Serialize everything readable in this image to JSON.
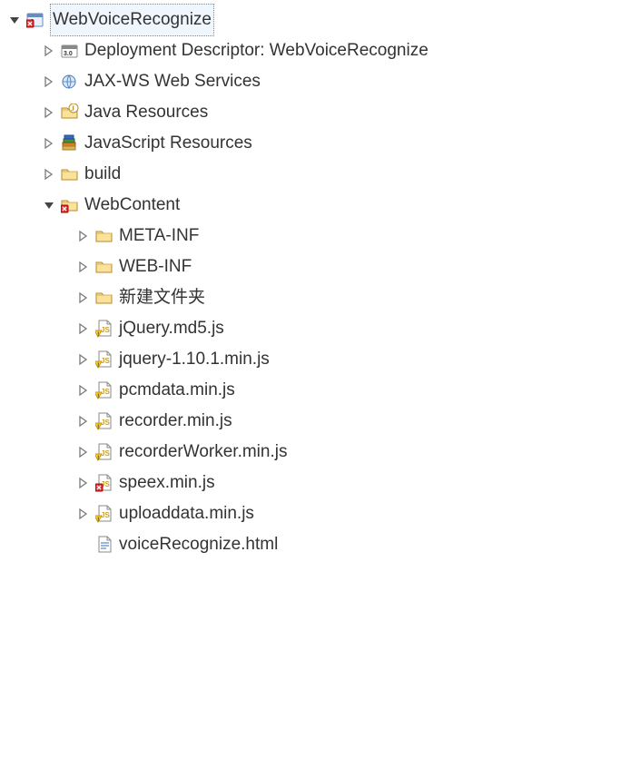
{
  "tree": [
    {
      "id": "root",
      "depth": 0,
      "arrow": "down",
      "icon": "project-error",
      "label": "WebVoiceRecognize",
      "selected": true,
      "expandable": true
    },
    {
      "id": "dd",
      "depth": 1,
      "arrow": "right",
      "icon": "deployment",
      "label": "Deployment Descriptor: WebVoiceRecognize",
      "expandable": true
    },
    {
      "id": "jaxws",
      "depth": 1,
      "arrow": "right",
      "icon": "webservices",
      "label": "JAX-WS Web Services",
      "expandable": true
    },
    {
      "id": "javares",
      "depth": 1,
      "arrow": "right",
      "icon": "javares",
      "label": "Java Resources",
      "expandable": true
    },
    {
      "id": "jsres",
      "depth": 1,
      "arrow": "right",
      "icon": "jsres",
      "label": "JavaScript Resources",
      "expandable": true
    },
    {
      "id": "build",
      "depth": 1,
      "arrow": "right",
      "icon": "folder",
      "label": "build",
      "expandable": true
    },
    {
      "id": "webcontent",
      "depth": 1,
      "arrow": "down",
      "icon": "folder-error",
      "label": "WebContent",
      "expandable": true
    },
    {
      "id": "metainf",
      "depth": 2,
      "arrow": "right",
      "icon": "folder",
      "label": "META-INF",
      "expandable": true
    },
    {
      "id": "webinf",
      "depth": 2,
      "arrow": "right",
      "icon": "folder",
      "label": "WEB-INF",
      "expandable": true
    },
    {
      "id": "newfolder",
      "depth": 2,
      "arrow": "right",
      "icon": "folder",
      "label": "新建文件夹",
      "expandable": true
    },
    {
      "id": "jquerymd5",
      "depth": 2,
      "arrow": "right",
      "icon": "jsfile-warn",
      "label": "jQuery.md5.js",
      "expandable": true
    },
    {
      "id": "jquery1101",
      "depth": 2,
      "arrow": "right",
      "icon": "jsfile-warn",
      "label": "jquery-1.10.1.min.js",
      "expandable": true
    },
    {
      "id": "pcmdata",
      "depth": 2,
      "arrow": "right",
      "icon": "jsfile-warn",
      "label": "pcmdata.min.js",
      "expandable": true
    },
    {
      "id": "recorder",
      "depth": 2,
      "arrow": "right",
      "icon": "jsfile-warn",
      "label": "recorder.min.js",
      "expandable": true
    },
    {
      "id": "recorderwkr",
      "depth": 2,
      "arrow": "right",
      "icon": "jsfile-warn",
      "label": "recorderWorker.min.js",
      "expandable": true
    },
    {
      "id": "speex",
      "depth": 2,
      "arrow": "right",
      "icon": "jsfile-error",
      "label": "speex.min.js",
      "expandable": true
    },
    {
      "id": "uploaddata",
      "depth": 2,
      "arrow": "right",
      "icon": "jsfile-warn",
      "label": "uploaddata.min.js",
      "expandable": true
    },
    {
      "id": "voicerecog",
      "depth": 2,
      "arrow": "none",
      "icon": "htmlfile",
      "label": "voiceRecognize.html",
      "expandable": false
    }
  ]
}
